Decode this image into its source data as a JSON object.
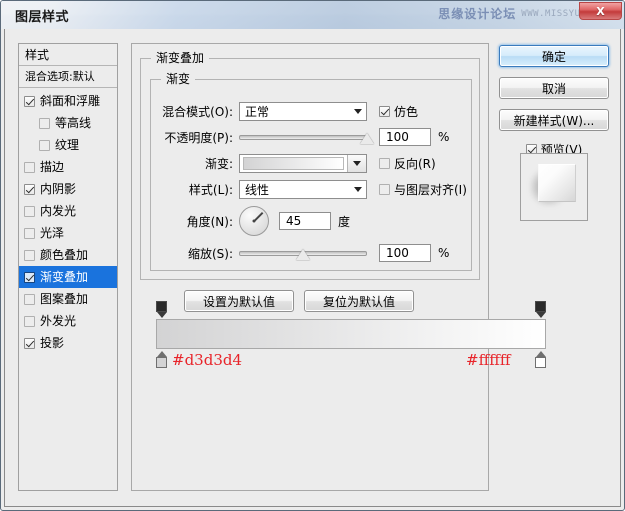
{
  "window": {
    "title": "图层样式",
    "close_label": "X",
    "watermark_cn": "思缘设计论坛",
    "watermark_url": "WWW.MISSYUAN.COM"
  },
  "sidebar": {
    "header": "样式",
    "blending_options": "混合选项:默认",
    "items": [
      {
        "label": "斜面和浮雕",
        "checked": true,
        "indent": false,
        "selected": false,
        "dim": false
      },
      {
        "label": "等高线",
        "checked": false,
        "indent": true,
        "selected": false,
        "dim": true
      },
      {
        "label": "纹理",
        "checked": false,
        "indent": true,
        "selected": false,
        "dim": true
      },
      {
        "label": "描边",
        "checked": false,
        "indent": false,
        "selected": false,
        "dim": true
      },
      {
        "label": "内阴影",
        "checked": true,
        "indent": false,
        "selected": false,
        "dim": false
      },
      {
        "label": "内发光",
        "checked": false,
        "indent": false,
        "selected": false,
        "dim": true
      },
      {
        "label": "光泽",
        "checked": false,
        "indent": false,
        "selected": false,
        "dim": true
      },
      {
        "label": "颜色叠加",
        "checked": false,
        "indent": false,
        "selected": false,
        "dim": true
      },
      {
        "label": "渐变叠加",
        "checked": true,
        "indent": false,
        "selected": true,
        "dim": false
      },
      {
        "label": "图案叠加",
        "checked": false,
        "indent": false,
        "selected": false,
        "dim": true
      },
      {
        "label": "外发光",
        "checked": false,
        "indent": false,
        "selected": false,
        "dim": true
      },
      {
        "label": "投影",
        "checked": true,
        "indent": false,
        "selected": false,
        "dim": false
      }
    ]
  },
  "panel": {
    "group_title": "渐变叠加",
    "subgroup_title": "渐变",
    "blend_mode": {
      "label": "混合模式(O):",
      "value": "正常"
    },
    "dither": {
      "label": "仿色",
      "checked": true
    },
    "opacity": {
      "label": "不透明度(P):",
      "value": "100",
      "unit": "%",
      "percent": 100
    },
    "gradient": {
      "label": "渐变:",
      "from": "#d3d3d4",
      "to": "#ffffff"
    },
    "reverse": {
      "label": "反向(R)",
      "checked": false
    },
    "style": {
      "label": "样式(L):",
      "value": "线性"
    },
    "align_layer": {
      "label": "与图层对齐(I)",
      "checked": false
    },
    "angle": {
      "label": "角度(N):",
      "value": "45",
      "unit": "度",
      "degrees": 45
    },
    "scale": {
      "label": "缩放(S):",
      "value": "100",
      "unit": "%",
      "percent": 50
    },
    "set_default_button": "设置为默认值",
    "reset_default_button": "复位为默认值"
  },
  "actions": {
    "ok": "确定",
    "cancel": "取消",
    "new_style": "新建样式(W)...",
    "preview": {
      "label": "预览(V)",
      "checked": true
    }
  },
  "gradient_editor": {
    "left_hex": "#d3d3d4",
    "right_hex": "#ffffff",
    "left_color": "#d3d3d4",
    "right_color": "#ffffff"
  },
  "colors": {
    "accent": "#1a73dd",
    "annotation_red": "#e8242a",
    "dialog_bg": "#ececec"
  }
}
